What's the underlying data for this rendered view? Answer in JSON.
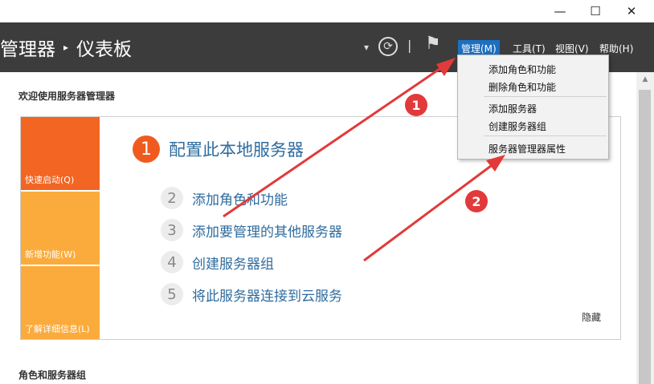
{
  "window": {
    "minimize_glyph": "—",
    "maximize_glyph": "☐",
    "close_glyph": "✕"
  },
  "header": {
    "breadcrumb_parent": "管理器",
    "breadcrumb_separator": "▸",
    "breadcrumb_current": "仪表板",
    "dropdown_glyph": "▾",
    "refresh_glyph": "⟳",
    "divider_glyph": "|",
    "flag_glyph": "⚑",
    "menus": {
      "manage": "管理(M)",
      "tools": "工具(T)",
      "view": "视图(V)",
      "help": "帮助(H)"
    }
  },
  "manage_menu": {
    "add_roles": "添加角色和功能",
    "remove_roles": "删除角色和功能",
    "add_servers": "添加服务器",
    "create_group": "创建服务器组",
    "properties": "服务器管理器属性"
  },
  "welcome": {
    "title": "欢迎使用服务器管理器",
    "tiles": {
      "quick_start": "快速启动(Q)",
      "whats_new": "新增功能(W)",
      "learn_more": "了解详细信息(L)"
    },
    "steps": [
      {
        "num": "1",
        "label": "配置此本地服务器"
      },
      {
        "num": "2",
        "label": "添加角色和功能"
      },
      {
        "num": "3",
        "label": "添加要管理的其他服务器"
      },
      {
        "num": "4",
        "label": "创建服务器组"
      },
      {
        "num": "5",
        "label": "将此服务器连接到云服务"
      }
    ],
    "hide": "隐藏"
  },
  "roles_section": {
    "title": "角色和服务器组"
  },
  "annotations": {
    "badge1": "1",
    "badge2": "2"
  },
  "colors": {
    "header_bg": "#3c3c3c",
    "accent_blue": "#1d6fc0",
    "quick_start_tile": "#f26522",
    "tile_orange": "#fbab3c",
    "step_one": "#f05a1e",
    "link_blue": "#2f6c9e",
    "annotation_red": "#e23a3a"
  },
  "icons": {
    "refresh": "refresh-icon",
    "flag": "notification-flag-icon",
    "dropdown": "chevron-down-icon"
  }
}
